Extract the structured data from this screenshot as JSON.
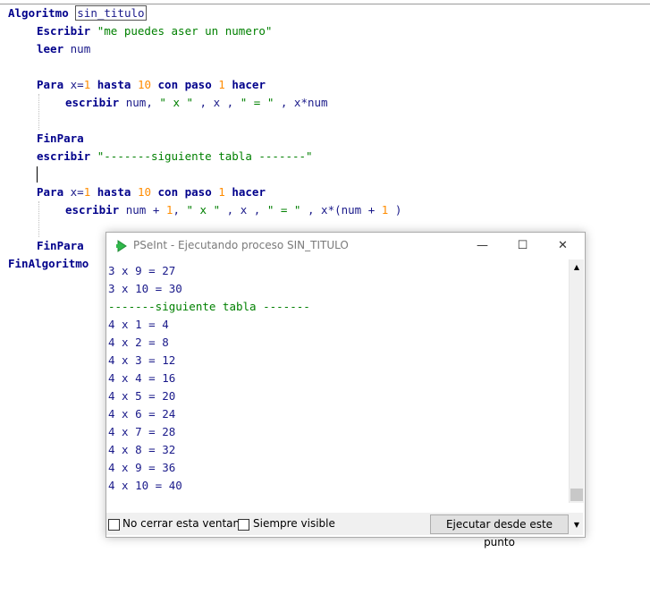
{
  "editor": {
    "lines": {
      "l1": {
        "kw": "Algoritmo",
        "name": "sin_titulo"
      },
      "l2": {
        "kw": "Escribir",
        "str": "\"me puedes aser un numero\""
      },
      "l3": {
        "kw": "leer",
        "var": "num"
      },
      "l5": {
        "kw1": "Para",
        "var": "x",
        "op": "=",
        "n1": "1",
        "kw2": "hasta",
        "n2": "10",
        "kw3": "con paso",
        "n3": "1",
        "kw4": "hacer"
      },
      "l6": {
        "kw": "escribir",
        "pre": "num, ",
        "s1": "\" x \"",
        "mid1": " , x , ",
        "s2": "\" = \"",
        "post": " , x*num"
      },
      "l8": {
        "kw": "FinPara"
      },
      "l9": {
        "kw": "escribir",
        "str": "\"-------siguiente tabla -------\""
      },
      "l11": {
        "kw1": "Para",
        "var": "x",
        "op": "=",
        "n1": "1",
        "kw2": "hasta",
        "n2": "10",
        "kw3": "con paso",
        "n3": "1",
        "kw4": "hacer"
      },
      "l12": {
        "kw": "escribir",
        "pre": "num + ",
        "n": "1",
        "sep": ", ",
        "s1": "\" x \"",
        "mid1": " , x , ",
        "s2": "\" = \"",
        "post": " , x*(num + ",
        "n2": "1",
        "end": " )"
      },
      "l14": {
        "kw": "FinPara"
      },
      "l15": {
        "kw": "FinAlgoritmo"
      }
    }
  },
  "window": {
    "title": "PSeInt - Ejecutando proceso SIN_TITULO",
    "minimize": "—",
    "maximize": "☐",
    "close": "✕",
    "output": [
      "3 x 9 = 27",
      "3 x 10 = 30",
      "-------siguiente tabla -------",
      "4 x 1 = 4",
      "4 x 2 = 8",
      "4 x 3 = 12",
      "4 x 4 = 16",
      "4 x 5 = 20",
      "4 x 6 = 24",
      "4 x 7 = 28",
      "4 x 8 = 32",
      "4 x 9 = 36",
      "4 x 10 = 40"
    ],
    "footer": {
      "no_close_label": "No cerrar esta ventana",
      "always_visible_label": "Siempre visible",
      "run_from_here_label": "Ejecutar desde este punto"
    }
  },
  "colors": {
    "keyword": "#00008b",
    "string": "#008000",
    "number": "#ff8c00"
  }
}
